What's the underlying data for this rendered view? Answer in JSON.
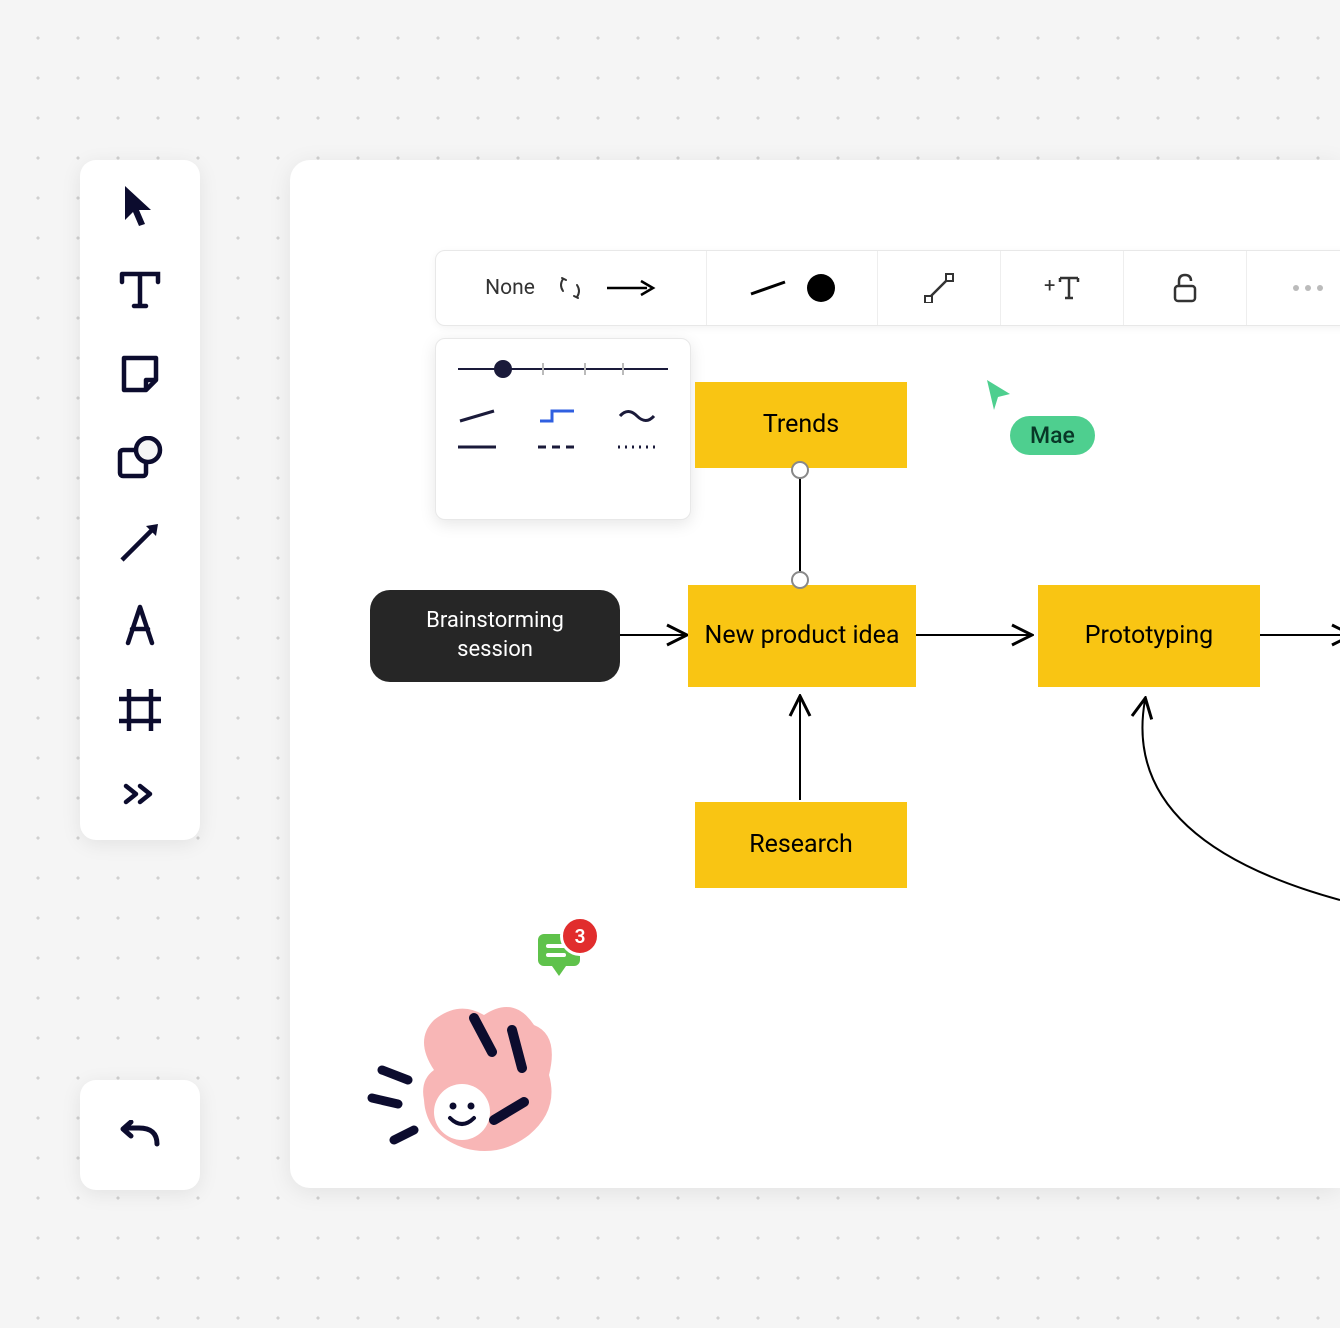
{
  "toolbar": {
    "tools": [
      "select",
      "text",
      "sticky",
      "shape",
      "connector",
      "pen",
      "frame",
      "more"
    ]
  },
  "context_bar": {
    "arrow_start_label": "None"
  },
  "nodes": {
    "brainstorm": "Brainstorming session",
    "trends": "Trends",
    "new_idea": "New product idea",
    "research": "Research",
    "prototyping": "Prototyping"
  },
  "collaborator": {
    "name": "Mae",
    "color": "#4ecf8f"
  },
  "comment_notifications": "3"
}
